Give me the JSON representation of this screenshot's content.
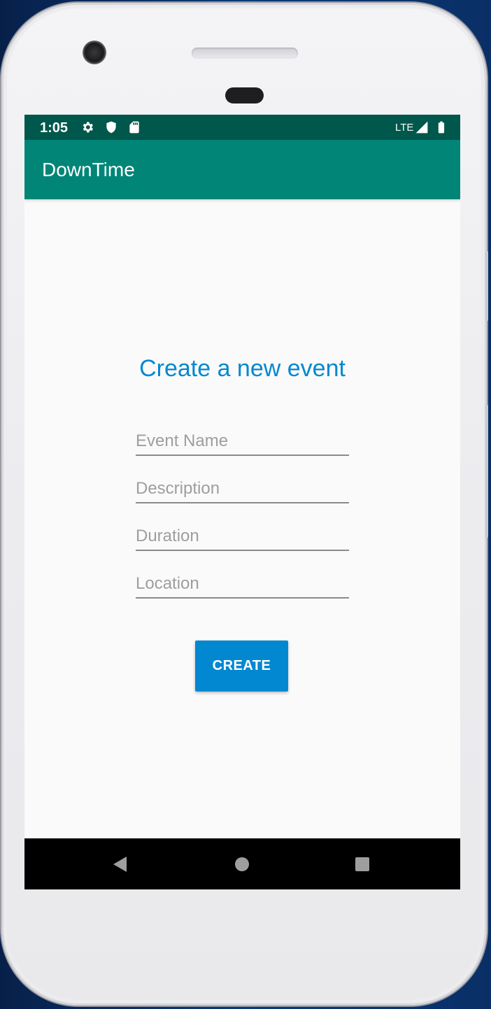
{
  "status_bar": {
    "time": "1:05",
    "network": "LTE",
    "icons": [
      "gear-icon",
      "shield-icon",
      "sd-card-icon",
      "signal-icon",
      "battery-icon"
    ]
  },
  "app_bar": {
    "title": "DownTime",
    "color": "#008577"
  },
  "form": {
    "heading": "Create a new event",
    "fields": [
      {
        "placeholder": "Event Name",
        "value": ""
      },
      {
        "placeholder": "Description",
        "value": ""
      },
      {
        "placeholder": "Duration",
        "value": ""
      },
      {
        "placeholder": "Location",
        "value": ""
      }
    ],
    "submit_label": "CREATE",
    "accent": "#0288d1"
  },
  "nav_bar": {
    "keys": [
      "back-icon",
      "home-icon",
      "recents-icon"
    ]
  }
}
